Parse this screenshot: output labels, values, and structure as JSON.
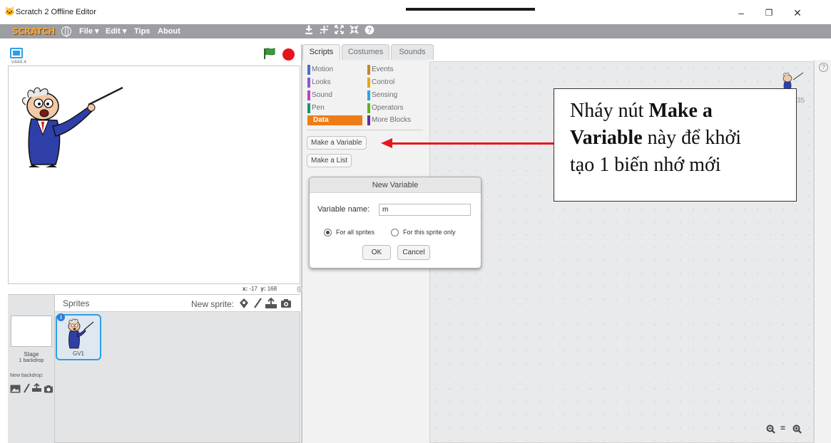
{
  "window": {
    "title": "Scratch 2 Offline Editor",
    "minimize": "–",
    "restore": "❐",
    "close": "✕"
  },
  "menubar": {
    "logo": "SCRATCH",
    "items": [
      {
        "label": "File ▾"
      },
      {
        "label": "Edit ▾"
      },
      {
        "label": "Tips"
      },
      {
        "label": "About"
      }
    ],
    "tools": [
      "duplicate-icon",
      "cut-icon",
      "grow-icon",
      "shrink-icon",
      "help-icon"
    ]
  },
  "stage": {
    "version": "v444.4",
    "coords": {
      "x_label": "x:",
      "x": "-17",
      "y_label": "y:",
      "y": "168"
    }
  },
  "sprites": {
    "title": "Sprites",
    "new_sprite_label": "New sprite:",
    "stage_name": "Stage",
    "stage_backdrops": "1 backdrop",
    "new_backdrop": "New backdrop:",
    "items": [
      {
        "name": "GV1"
      }
    ]
  },
  "tabs": [
    {
      "label": "Scripts",
      "active": true
    },
    {
      "label": "Costumes"
    },
    {
      "label": "Sounds"
    }
  ],
  "palette": {
    "categories": [
      {
        "label": "Motion",
        "color": "#4a6cd4"
      },
      {
        "label": "Looks",
        "color": "#8a55d7"
      },
      {
        "label": "Sound",
        "color": "#bb42c3"
      },
      {
        "label": "Pen",
        "color": "#0e9a6c"
      },
      {
        "label": "Data",
        "color": "#ee7d16",
        "selected": true
      },
      {
        "label": "Events",
        "color": "#c88330"
      },
      {
        "label": "Control",
        "color": "#e1a91a"
      },
      {
        "label": "Sensing",
        "color": "#2ca5e2"
      },
      {
        "label": "Operators",
        "color": "#5cb712"
      },
      {
        "label": "More Blocks",
        "color": "#632d99"
      }
    ],
    "make_variable": "Make a Variable",
    "make_list": "Make a List"
  },
  "dialog": {
    "title": "New Variable",
    "name_label": "Variable name:",
    "name_value": "m",
    "option_all": "For all sprites",
    "option_this": "For this sprite only",
    "ok": "OK",
    "cancel": "Cancel"
  },
  "script_area": {
    "xy_hint": "35",
    "zoom_out": "🔍−",
    "zoom_reset": "=",
    "zoom_in": "🔍+"
  },
  "annotation": {
    "text_1": "Nháy nút ",
    "bold_1": "Make a",
    "bold_2": "Variable",
    "text_2": " này để khởi",
    "text_3": "tạo 1 biến nhớ mới"
  },
  "colors": {
    "menubar": "#9c9ea2",
    "accent": "#2ba0e8",
    "data_category": "#ee7d16",
    "annotation_arrow": "#e8161c"
  }
}
